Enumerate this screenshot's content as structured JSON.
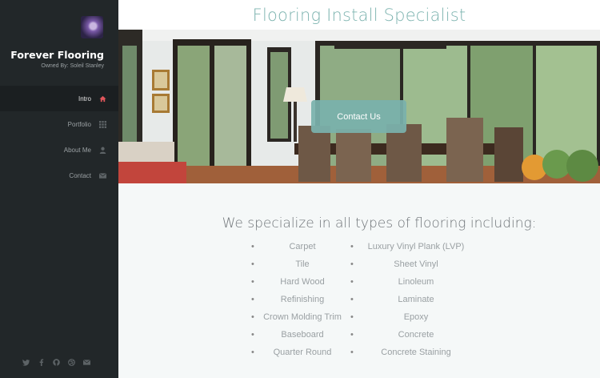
{
  "sidebar": {
    "brand_title": "Forever Flooring",
    "brand_subtitle": "Owned By: Soleil Stanley",
    "nav": [
      {
        "label": "Intro",
        "icon": "home-icon",
        "active": true
      },
      {
        "label": "Portfolio",
        "icon": "grid-icon",
        "active": false
      },
      {
        "label": "About Me",
        "icon": "user-icon",
        "active": false
      },
      {
        "label": "Contact",
        "icon": "envelope-icon",
        "active": false
      }
    ],
    "social": [
      "twitter-icon",
      "facebook-icon",
      "github-icon",
      "dribbble-icon",
      "email-icon"
    ]
  },
  "header": {
    "title": "Flooring Install Specialist"
  },
  "hero": {
    "cta_label": "Contact Us"
  },
  "content": {
    "heading": "We specialize in all types of flooring including:",
    "list_left": [
      "Carpet",
      "Tile",
      "Hard Wood",
      "Refinishing",
      "Crown Molding Trim",
      "Baseboard",
      "Quarter Round"
    ],
    "list_right": [
      "Luxury Vinyl Plank (LVP)",
      "Sheet Vinyl",
      "Linoleum",
      "Laminate",
      "Epoxy",
      "Concrete",
      "Concrete Staining"
    ]
  },
  "colors": {
    "accent": "#7eb4b0",
    "sidebar_bg": "#222729",
    "active_icon": "#e0565b"
  }
}
